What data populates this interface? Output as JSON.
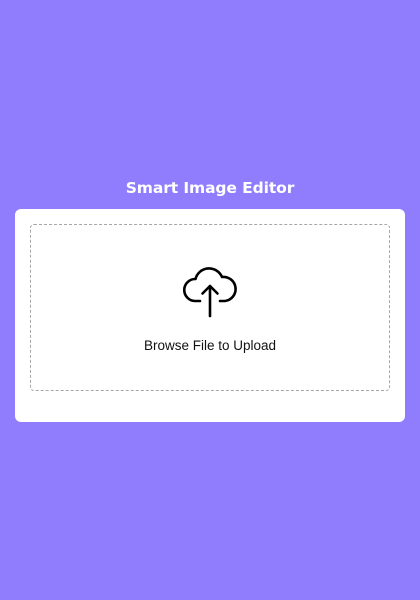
{
  "header": {
    "title": "Smart Image Editor"
  },
  "upload": {
    "label": "Browse File to Upload",
    "icon": "cloud-upload-icon"
  },
  "colors": {
    "background": "#8f7dfd",
    "card": "#ffffff",
    "title_text": "#ffffff",
    "dropzone_border": "#a6a6a6",
    "label_text": "#111111"
  }
}
